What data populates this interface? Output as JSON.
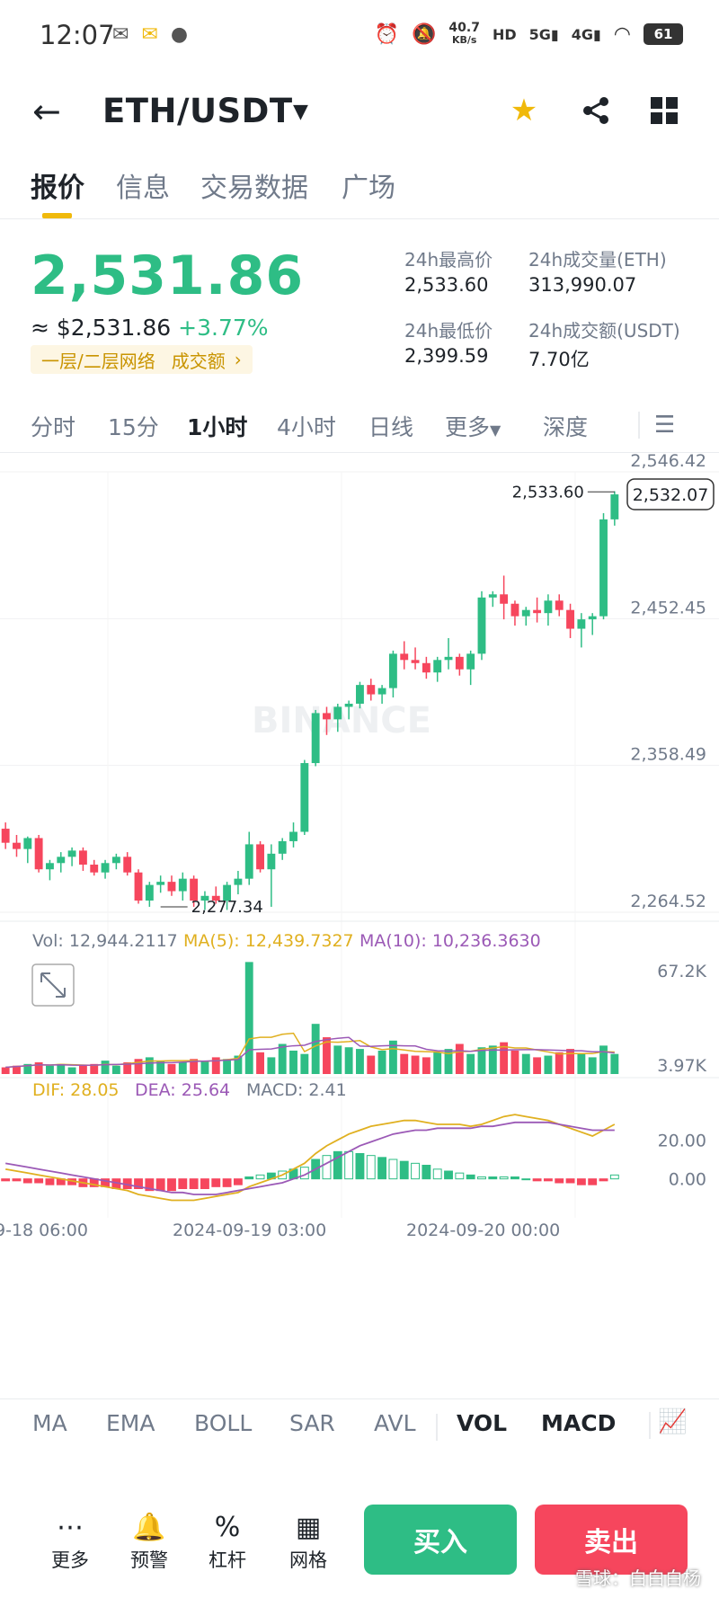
{
  "status": {
    "time": "12:07",
    "net_speed": "40.7",
    "net_unit": "KB/s",
    "battery": "61"
  },
  "header": {
    "pair": "ETH/USDT"
  },
  "tabs": [
    "报价",
    "信息",
    "交易数据",
    "广场"
  ],
  "price": {
    "last": "2,531.86",
    "usd": "≈ $2,531.86",
    "change": "+3.77%",
    "tag1": "一层/二层网络",
    "tag2": "成交额"
  },
  "stats": {
    "high_label": "24h最高价",
    "high": "2,533.60",
    "vol_eth_label": "24h成交量(ETH)",
    "vol_eth": "313,990.07",
    "low_label": "24h最低价",
    "low": "2,399.59",
    "vol_usdt_label": "24h成交额(USDT)",
    "vol_usdt": "7.70亿"
  },
  "intervals": [
    "分时",
    "15分",
    "1小时",
    "4小时",
    "日线",
    "更多",
    "深度"
  ],
  "colors": {
    "up": "#2ebd85",
    "down": "#f6465d",
    "ma5": "#e0b020",
    "ma10": "#9b59b6",
    "accent": "#f0b90b"
  },
  "chart_data": {
    "type": "candlestick",
    "price_axis": [
      "2,546.42",
      "2,452.45",
      "2,358.49",
      "2,264.52"
    ],
    "ylim": [
      2264.52,
      2546.42
    ],
    "high_marker": "2,533.60",
    "low_marker": "2,277.34",
    "current_tag": "2,532.07",
    "watermark": "BINANCE",
    "candles": [
      [
        2318,
        2322,
        2305,
        2309
      ],
      [
        2309,
        2314,
        2300,
        2305
      ],
      [
        2305,
        2313,
        2296,
        2312
      ],
      [
        2312,
        2314,
        2290,
        2292
      ],
      [
        2292,
        2298,
        2285,
        2296
      ],
      [
        2296,
        2303,
        2290,
        2300
      ],
      [
        2300,
        2306,
        2294,
        2304
      ],
      [
        2304,
        2306,
        2291,
        2295
      ],
      [
        2295,
        2298,
        2288,
        2290
      ],
      [
        2290,
        2298,
        2286,
        2296
      ],
      [
        2296,
        2302,
        2292,
        2300
      ],
      [
        2300,
        2303,
        2288,
        2290
      ],
      [
        2290,
        2292,
        2270,
        2272
      ],
      [
        2272,
        2284,
        2268,
        2282
      ],
      [
        2282,
        2288,
        2277,
        2284
      ],
      [
        2284,
        2288,
        2275,
        2278
      ],
      [
        2278,
        2290,
        2272,
        2286
      ],
      [
        2286,
        2288,
        2268,
        2272
      ],
      [
        2272,
        2278,
        2266,
        2275
      ],
      [
        2275,
        2281,
        2270,
        2272
      ],
      [
        2272,
        2284,
        2266,
        2282
      ],
      [
        2282,
        2291,
        2276,
        2286
      ],
      [
        2286,
        2316,
        2282,
        2308
      ],
      [
        2308,
        2310,
        2290,
        2292
      ],
      [
        2292,
        2308,
        2268,
        2302
      ],
      [
        2302,
        2312,
        2298,
        2310
      ],
      [
        2310,
        2322,
        2306,
        2316
      ],
      [
        2316,
        2362,
        2314,
        2360
      ],
      [
        2360,
        2394,
        2358,
        2392
      ],
      [
        2392,
        2396,
        2378,
        2388
      ],
      [
        2388,
        2398,
        2380,
        2396
      ],
      [
        2396,
        2400,
        2388,
        2398
      ],
      [
        2398,
        2412,
        2395,
        2410
      ],
      [
        2410,
        2414,
        2400,
        2404
      ],
      [
        2404,
        2410,
        2398,
        2408
      ],
      [
        2408,
        2432,
        2402,
        2430
      ],
      [
        2430,
        2438,
        2420,
        2426
      ],
      [
        2426,
        2434,
        2420,
        2424
      ],
      [
        2424,
        2428,
        2414,
        2418
      ],
      [
        2418,
        2428,
        2412,
        2426
      ],
      [
        2426,
        2440,
        2420,
        2428
      ],
      [
        2428,
        2430,
        2416,
        2420
      ],
      [
        2420,
        2432,
        2410,
        2430
      ],
      [
        2430,
        2470,
        2426,
        2466
      ],
      [
        2466,
        2470,
        2460,
        2468
      ],
      [
        2468,
        2480,
        2452,
        2462
      ],
      [
        2462,
        2464,
        2448,
        2454
      ],
      [
        2454,
        2460,
        2448,
        2458
      ],
      [
        2458,
        2466,
        2450,
        2456
      ],
      [
        2456,
        2468,
        2448,
        2464
      ],
      [
        2464,
        2468,
        2454,
        2458
      ],
      [
        2458,
        2462,
        2440,
        2446
      ],
      [
        2446,
        2456,
        2434,
        2452
      ],
      [
        2452,
        2456,
        2442,
        2454
      ],
      [
        2454,
        2520,
        2452,
        2516
      ],
      [
        2516,
        2534,
        2512,
        2532
      ]
    ],
    "volume": {
      "label": "Vol: 12,944.2117",
      "ma5_label": "MA(5): 12,439.7327",
      "ma10_label": "MA(10): 10,236.3630",
      "axis": [
        "67.2K",
        "3.97K"
      ],
      "ylim": [
        0,
        67.2
      ],
      "values": [
        4,
        5,
        6,
        7,
        5,
        6,
        4,
        5,
        6,
        8,
        5,
        7,
        9,
        10,
        8,
        6,
        7,
        9,
        8,
        10,
        9,
        11,
        67,
        13,
        10,
        18,
        14,
        12,
        30,
        22,
        17,
        16,
        15,
        11,
        14,
        20,
        12,
        11,
        10,
        13,
        15,
        18,
        12,
        16,
        17,
        19,
        14,
        12,
        10,
        11,
        13,
        15,
        12,
        10,
        17,
        12
      ]
    },
    "macd": {
      "dif_label": "DIF: 28.05",
      "dea_label": "DEA: 25.64",
      "macd_label": "MACD: 2.41",
      "axis": [
        "20.00",
        "0.00"
      ],
      "ylim": [
        -20,
        40
      ],
      "hist": [
        -1,
        -1,
        -2,
        -2,
        -3,
        -3,
        -3,
        -4,
        -4,
        -4,
        -5,
        -5,
        -5,
        -6,
        -6,
        -6,
        -5,
        -5,
        -5,
        -4,
        -4,
        -3,
        1,
        2,
        3,
        4,
        5,
        6,
        10,
        12,
        14,
        14,
        13,
        12,
        11,
        10,
        9,
        8,
        7,
        5,
        4,
        3,
        2,
        1,
        1,
        1,
        1,
        0,
        -1,
        -1,
        -2,
        -2,
        -3,
        -3,
        -1,
        2
      ],
      "dif": [
        5,
        4,
        3,
        2,
        1,
        0,
        -1,
        -2,
        -3,
        -4,
        -5,
        -6,
        -8,
        -9,
        -10,
        -11,
        -11,
        -11,
        -10,
        -9,
        -8,
        -7,
        -4,
        -2,
        0,
        2,
        5,
        8,
        13,
        17,
        20,
        23,
        25,
        27,
        28,
        29,
        30,
        30,
        29,
        28,
        28,
        28,
        27,
        28,
        30,
        32,
        33,
        32,
        31,
        30,
        28,
        26,
        24,
        22,
        25,
        28
      ],
      "dea": [
        8,
        7,
        6,
        5,
        4,
        3,
        2,
        1,
        0,
        -1,
        -2,
        -3,
        -4,
        -5,
        -6,
        -7,
        -7,
        -8,
        -8,
        -8,
        -7,
        -6,
        -5,
        -4,
        -3,
        -2,
        0,
        2,
        5,
        8,
        11,
        14,
        17,
        19,
        21,
        23,
        24,
        25,
        25,
        26,
        26,
        26,
        26,
        27,
        27,
        28,
        29,
        29,
        29,
        29,
        28,
        27,
        26,
        25,
        25,
        25
      ]
    },
    "x_labels": [
      "9-18 06:00",
      "2024-09-19 03:00",
      "2024-09-20 00:00"
    ]
  },
  "indicators": [
    "MA",
    "EMA",
    "BOLL",
    "SAR",
    "AVL",
    "VOL",
    "MACD"
  ],
  "bottom_nav": {
    "more": "更多",
    "alert": "预警",
    "leverage": "杠杆",
    "grid": "网格",
    "buy": "买入",
    "sell": "卖出"
  },
  "watermark": "雪球：白白白杨"
}
